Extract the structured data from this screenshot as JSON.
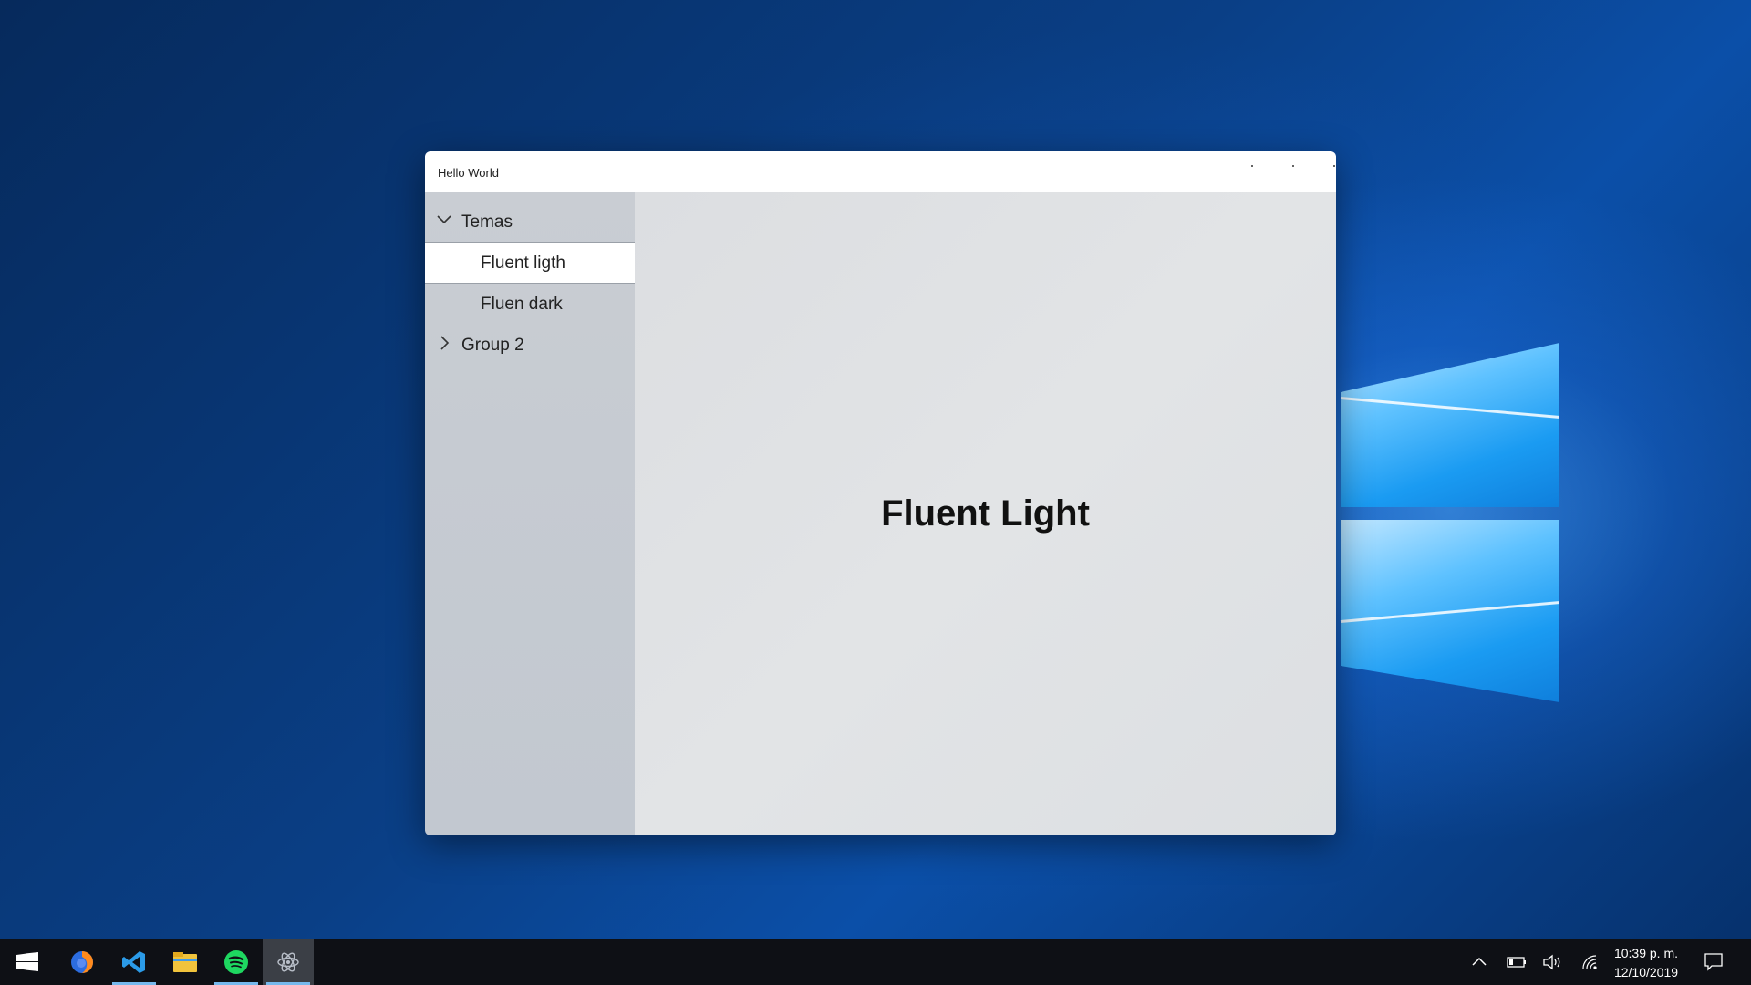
{
  "window": {
    "title": "Hello World"
  },
  "sidebar": {
    "items": [
      {
        "label": "Temas",
        "expanded": true
      },
      {
        "label": "Fluent ligth",
        "selected": true
      },
      {
        "label": "Fluen dark"
      },
      {
        "label": "Group 2",
        "expanded": false
      }
    ]
  },
  "main": {
    "heading": "Fluent Light"
  },
  "taskbar": {
    "icons": [
      "windows-start-icon",
      "firefox-icon",
      "vscode-icon",
      "file-explorer-icon",
      "spotify-icon",
      "electron-app-icon"
    ],
    "tray": [
      "show-hidden-icons-chevron",
      "battery-icon",
      "volume-icon",
      "wifi-icon",
      "notification-icon"
    ],
    "time": "10:39 p. m.",
    "date": "12/10/2019",
    "accent": "#76b9ed"
  }
}
